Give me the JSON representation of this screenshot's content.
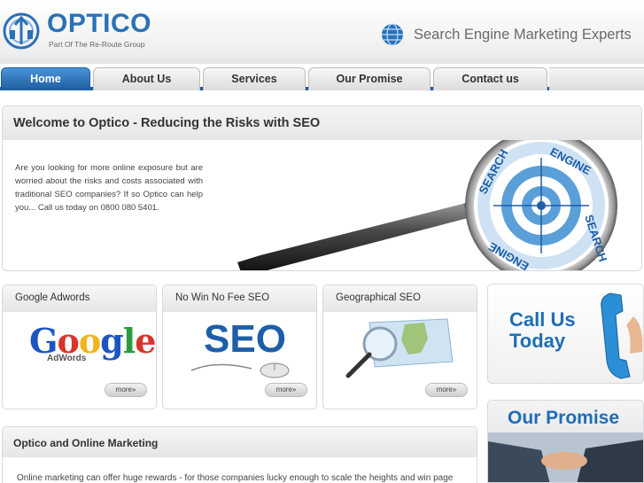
{
  "header": {
    "logo_text": "OPTICO",
    "logo_sub": "Part Of The Re-Route Group",
    "tagline": "Search Engine Marketing Experts"
  },
  "nav": {
    "tabs": [
      {
        "label": "Home",
        "active": true
      },
      {
        "label": "About Us",
        "active": false
      },
      {
        "label": "Services",
        "active": false
      },
      {
        "label": "Our Promise",
        "active": false
      },
      {
        "label": "Contact us",
        "active": false
      }
    ]
  },
  "welcome": {
    "title": "Welcome to Optico - Reducing the Risks with SEO",
    "body": "Are you looking for more online exposure but are worried about the risks and costs associated with traditional SEO companies? If so Optico can help you... Call us today on 0800 080 5401.",
    "hero_ring_top": "SEARCH",
    "hero_ring_top2": "ENGINE",
    "hero_ring_bottom": "SEARCH",
    "hero_ring_bottom2": "ENGINE"
  },
  "cards": [
    {
      "title": "Google Adwords",
      "more_label": "more»",
      "art_main": "Google",
      "art_sub": "AdWords"
    },
    {
      "title": "No Win No Fee SEO",
      "more_label": "more»",
      "art_main": "SEO"
    },
    {
      "title": "Geographical SEO",
      "more_label": "more»"
    }
  ],
  "callus": {
    "line1": "Call Us",
    "line2": "Today"
  },
  "promise": {
    "title": "Our Promise"
  },
  "bottom": {
    "title": "Optico and Online Marketing",
    "body": "Online marketing can offer huge rewards - for those companies lucky enough to scale the heights and win page"
  },
  "colors": {
    "brand_blue": "#2a71b8",
    "nav_active": "#1d5d9f"
  }
}
